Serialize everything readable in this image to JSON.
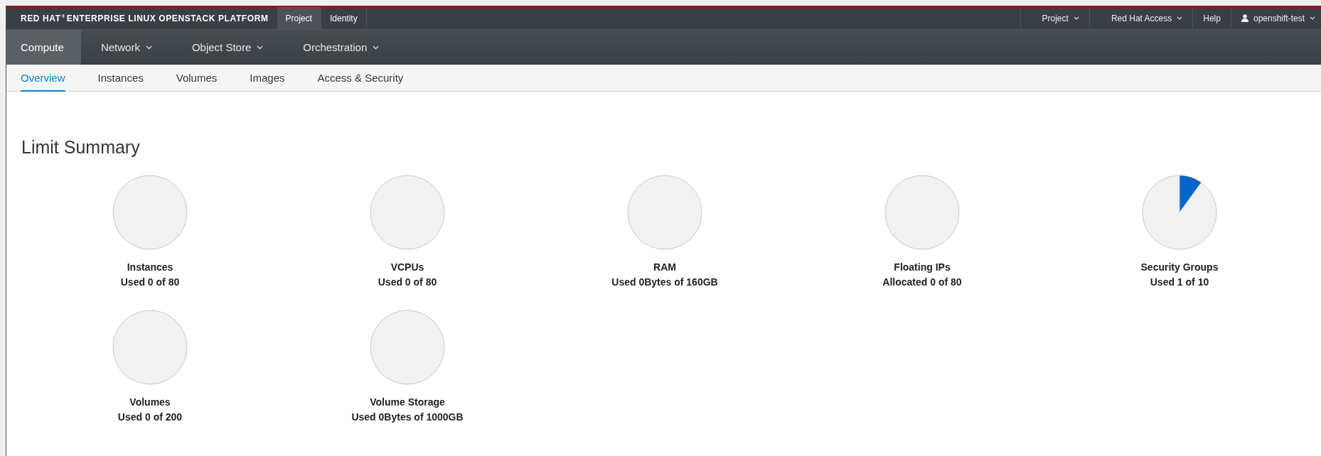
{
  "brand": {
    "name": "RED HAT",
    "mark": "®",
    "product": "ENTERPRISE LINUX OPENSTACK PLATFORM"
  },
  "top_tabs": [
    {
      "label": "Project",
      "selected": true
    },
    {
      "label": "Identity",
      "selected": false
    }
  ],
  "top_right": [
    {
      "label": "Project",
      "kind": "dropdown"
    },
    {
      "label": "Red Hat Access",
      "kind": "dropdown"
    },
    {
      "label": "Help",
      "kind": "link"
    },
    {
      "label": "openshift-test",
      "kind": "user"
    }
  ],
  "nav": [
    {
      "label": "Compute",
      "selected": true,
      "dropdown": false
    },
    {
      "label": "Network",
      "selected": false,
      "dropdown": true
    },
    {
      "label": "Object Store",
      "selected": false,
      "dropdown": true
    },
    {
      "label": "Orchestration",
      "selected": false,
      "dropdown": true
    }
  ],
  "subnav": [
    {
      "label": "Overview",
      "selected": true
    },
    {
      "label": "Instances",
      "selected": false
    },
    {
      "label": "Volumes",
      "selected": false
    },
    {
      "label": "Images",
      "selected": false
    },
    {
      "label": "Access & Security",
      "selected": false
    }
  ],
  "heading": "Limit Summary",
  "limits": [
    {
      "name": "Instances",
      "usage": "Used 0 of 80",
      "chart_data": {
        "type": "pie",
        "values": [
          0,
          100
        ]
      }
    },
    {
      "name": "VCPUs",
      "usage": "Used 0 of 80",
      "chart_data": {
        "type": "pie",
        "values": [
          0,
          100
        ]
      }
    },
    {
      "name": "RAM",
      "usage": "Used 0Bytes of 160GB",
      "chart_data": {
        "type": "pie",
        "values": [
          0,
          100
        ]
      }
    },
    {
      "name": "Floating IPs",
      "usage": "Allocated 0 of 80",
      "chart_data": {
        "type": "pie",
        "values": [
          0,
          100
        ]
      }
    },
    {
      "name": "Security Groups",
      "usage": "Used 1 of 10",
      "chart_data": {
        "type": "pie",
        "values": [
          10,
          90
        ]
      }
    },
    {
      "name": "Volumes",
      "usage": "Used 0 of 200",
      "chart_data": {
        "type": "pie",
        "values": [
          0,
          100
        ]
      }
    },
    {
      "name": "Volume Storage",
      "usage": "Used 0Bytes of 1000GB",
      "chart_data": {
        "type": "pie",
        "values": [
          0,
          100
        ]
      }
    }
  ]
}
